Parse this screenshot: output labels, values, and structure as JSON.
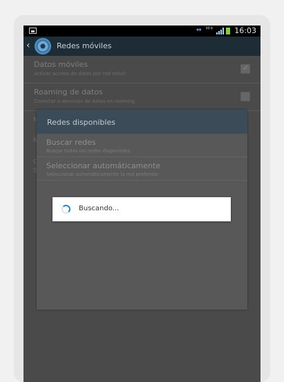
{
  "status_bar": {
    "net_badge": "H+",
    "time": "16:03",
    "icons": [
      "screenshot-icon",
      "sync-icon",
      "network-type-icon",
      "signal-icon",
      "battery-icon"
    ]
  },
  "action_bar": {
    "title": "Redes móviles",
    "icons": [
      "back-icon",
      "settings-gear-icon"
    ]
  },
  "settings_list": [
    {
      "title": "Datos móviles",
      "subtitle": "Activar acceso de datos por red móvil",
      "checked": true
    },
    {
      "title": "Roaming de datos",
      "subtitle": "Conectar a servicios de datos en roaming",
      "checked": false
    }
  ],
  "background_stubs": [
    "N",
    "N",
    "C",
    "S"
  ],
  "dialog": {
    "title": "Redes disponibles",
    "items": [
      {
        "title": "Buscar redes",
        "subtitle": "Buscar todas las redes disponibles"
      },
      {
        "title": "Seleccionar automáticamente",
        "subtitle": "Seleccionar automáticamente la red preferida"
      }
    ]
  },
  "progress": {
    "text": "Buscando..."
  },
  "colors": {
    "action_bar": "#1e2c36",
    "dialog_header": "#3b4b58",
    "spinner_accent": "#2f84c7"
  }
}
